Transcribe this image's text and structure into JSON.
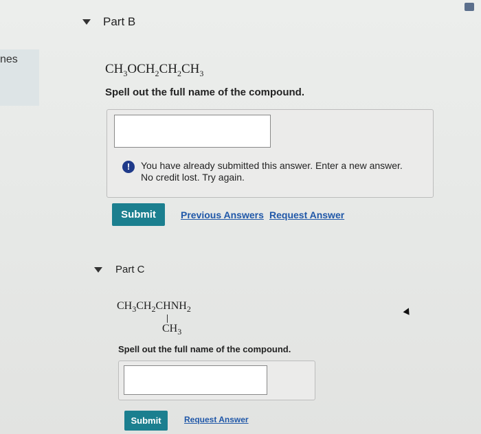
{
  "sidebar": {
    "tab_label": "nes"
  },
  "part_b": {
    "label": "Part B",
    "formula": {
      "p1": "CH",
      "s1": "3",
      "p2": "OCH",
      "s2": "2",
      "p3": "CH",
      "s3": "2",
      "p4": "CH",
      "s4": "3"
    },
    "prompt": "Spell out the full name of the compound.",
    "answer_value": "",
    "feedback_line1": "You have already submitted this answer. Enter a new answer.",
    "feedback_line2": "No credit lost. Try again.",
    "submit_label": "Submit",
    "previous_answers_label": "Previous Answers",
    "request_answer_label": "Request Answer"
  },
  "part_c": {
    "label": "Part C",
    "formula_top": {
      "p1": "CH",
      "s1": "3",
      "p2": "CH",
      "s2": "2",
      "p3": "CHNH",
      "s3": "2"
    },
    "formula_branch": {
      "p1": "CH",
      "s1": "3"
    },
    "prompt": "Spell out the full name of the compound.",
    "answer_value": "",
    "submit_label": "Submit",
    "request_answer_label": "Request Answer"
  },
  "colors": {
    "accent": "#1b7f8f",
    "link": "#1f57a8",
    "warning": "#1f3a8a"
  }
}
